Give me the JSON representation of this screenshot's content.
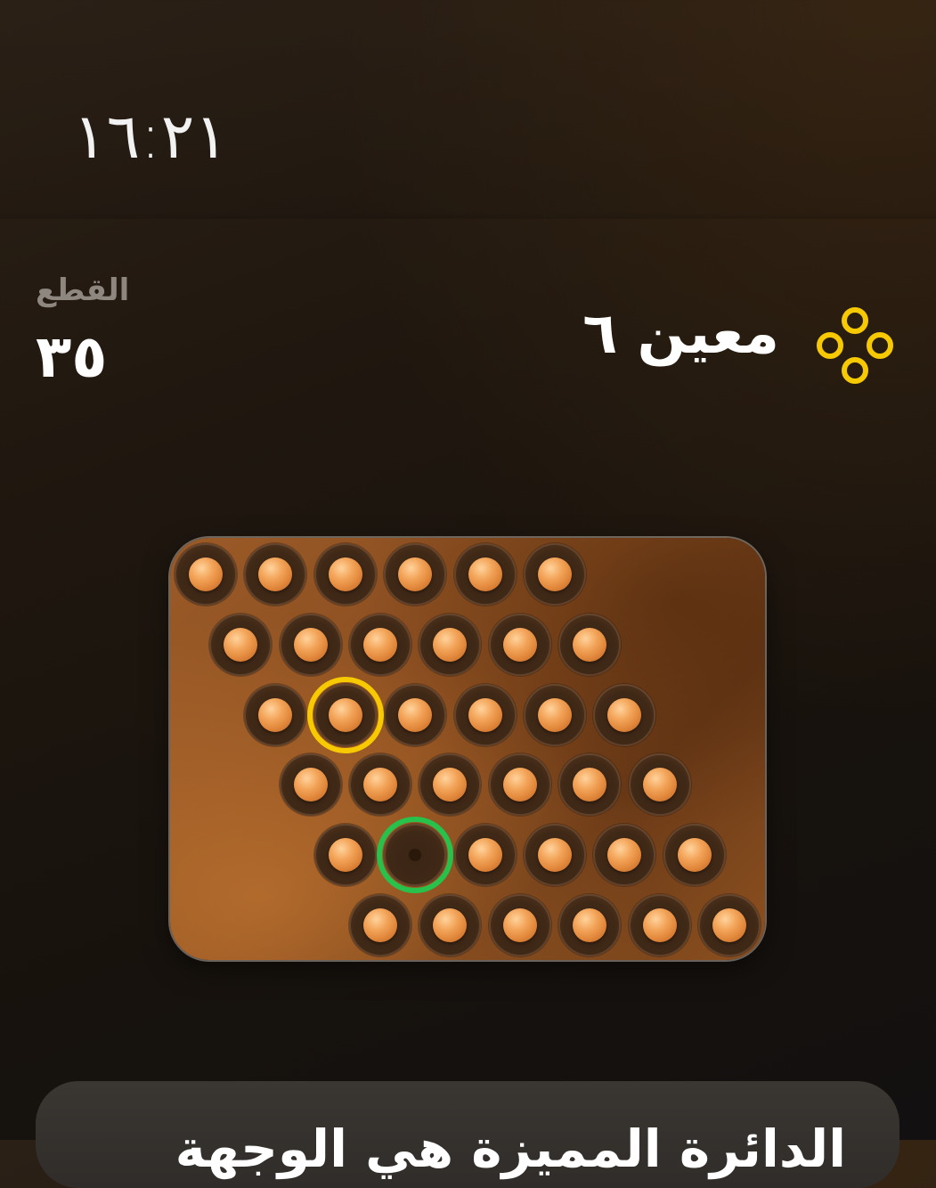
{
  "status_bar": {
    "time": "١٦:٢١"
  },
  "stats": {
    "pieces_label": "القطع",
    "pieces_count": "٣٥"
  },
  "shape": {
    "title": "معين ٦",
    "icon": "diamond-four-rings-icon"
  },
  "colors": {
    "accent_yellow": "#f6c900",
    "target_green": "#27c14b",
    "peg": "#e0863a",
    "board": "#8a4d1f"
  },
  "board": {
    "rows": 6,
    "cols": 6,
    "layout": "rhombus-shifted-right",
    "holes": [
      [
        "peg",
        "peg",
        "peg",
        "peg",
        "peg",
        "peg"
      ],
      [
        "peg",
        "peg",
        "peg",
        "peg",
        "peg",
        "peg"
      ],
      [
        "peg",
        "peg",
        "peg",
        "peg",
        "peg",
        "peg"
      ],
      [
        "peg",
        "peg",
        "peg",
        "peg",
        "peg",
        "peg"
      ],
      [
        "peg",
        "empty",
        "peg",
        "peg",
        "peg",
        "peg"
      ],
      [
        "peg",
        "peg",
        "peg",
        "peg",
        "peg",
        "peg"
      ]
    ],
    "selected": {
      "row": 2,
      "col": 1
    },
    "target": {
      "row": 4,
      "col": 1
    }
  },
  "bottom_card": {
    "text": "الدائرة المميزة هي الوجهة"
  }
}
